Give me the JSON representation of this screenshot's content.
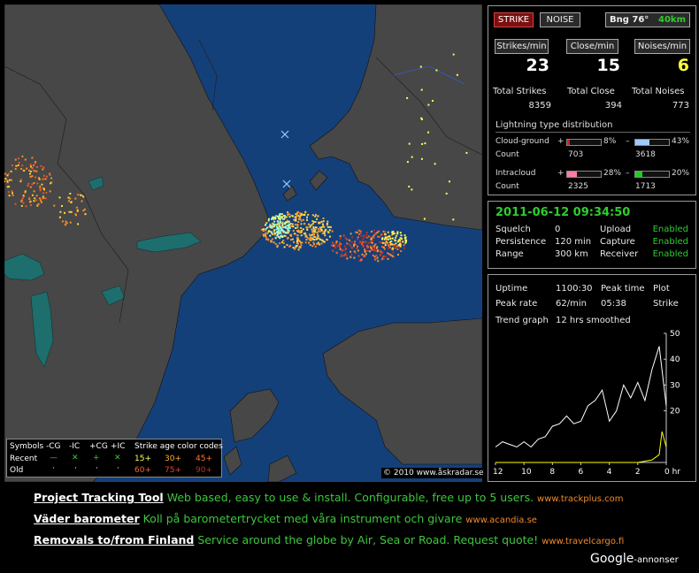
{
  "panel": {
    "strike_btn": "STRIKE",
    "noise_btn": "NOISE",
    "bearing": "Bng 76°",
    "range_km": "40km",
    "strikes_per_min_label": "Strikes/min",
    "close_per_min_label": "Close/min",
    "noises_per_min_label": "Noises/min",
    "strikes_per_min": "23",
    "close_per_min": "15",
    "noises_per_min": "6",
    "total_strikes_label": "Total Strikes",
    "total_close_label": "Total Close",
    "total_noises_label": "Total Noises",
    "total_strikes": "8359",
    "total_close": "394",
    "total_noises": "773",
    "dist_title": "Lightning type distribution",
    "cg_label": "Cloud-ground",
    "ic_label": "Intracloud",
    "count_label": "Count",
    "plus": "+",
    "minus": "–",
    "cg_plus_pct": "8%",
    "cg_minus_pct": "43%",
    "cg_plus_count": "703",
    "cg_minus_count": "3618",
    "ic_plus_pct": "28%",
    "ic_minus_pct": "20%",
    "ic_plus_count": "2325",
    "ic_minus_count": "1713",
    "colors": {
      "cg_plus": "#cc2222",
      "cg_minus": "#9ec9ff",
      "ic_plus": "#ff7aa8",
      "ic_minus": "#22cc22"
    }
  },
  "status": {
    "datetime": "2011-06-12 09:34:50",
    "squelch_label": "Squelch",
    "squelch": "0",
    "persistence_label": "Persistence",
    "persistence": "120 min",
    "range_label": "Range",
    "range": "300 km",
    "upload_label": "Upload",
    "upload": "Enabled",
    "capture_label": "Capture",
    "capture": "Enabled",
    "receiver_label": "Receiver",
    "receiver": "Enabled"
  },
  "stats": {
    "uptime_label": "Uptime",
    "uptime": "1100:30",
    "peak_time_label": "Peak time",
    "peak_time": "05:38",
    "plot_label": "Plot",
    "plot": "Strike",
    "peak_rate_label": "Peak rate",
    "peak_rate": "62/min",
    "trend_label": "Trend graph",
    "trend": "12 hrs smoothed"
  },
  "chart_data": {
    "type": "line",
    "x_ticks": [
      "12",
      "10",
      "8",
      "6",
      "4",
      "2",
      "0 hr"
    ],
    "y_ticks": [
      "50",
      "40",
      "30",
      "20"
    ],
    "ylim": [
      0,
      50
    ],
    "xlim": [
      12,
      0
    ],
    "series": [
      {
        "color": "#ffffff",
        "x": [
          12,
          11.5,
          11,
          10.5,
          10,
          9.5,
          9,
          8.5,
          8,
          7.5,
          7,
          6.5,
          6,
          5.5,
          5,
          4.5,
          4,
          3.5,
          3,
          2.5,
          2,
          1.5,
          1,
          0.5,
          0
        ],
        "values": [
          6,
          8,
          7,
          6,
          8,
          6,
          9,
          10,
          14,
          15,
          18,
          15,
          16,
          22,
          24,
          28,
          16,
          20,
          30,
          25,
          31,
          24,
          36,
          45,
          22
        ]
      },
      {
        "color": "#ffff00",
        "x": [
          12,
          10,
          8,
          6,
          4,
          2,
          1,
          0.5,
          0.3,
          0
        ],
        "values": [
          0,
          0,
          0,
          0,
          0,
          0,
          1,
          3,
          12,
          6
        ]
      }
    ]
  },
  "map": {
    "copyright": "© 2010 www.åskradar.se",
    "legend": {
      "symbols_label": "Symbols",
      "cols": [
        "-CG",
        "-IC",
        "+CG",
        "+IC"
      ],
      "recent_label": "Recent",
      "old_label": "Old",
      "recent_syms": [
        "—",
        "✕",
        "+",
        "✕"
      ],
      "age_title": "Strike age color codes",
      "age_recent": [
        "15+",
        "30+",
        "45+"
      ],
      "age_old": [
        "60+",
        "75+",
        "90+"
      ]
    }
  },
  "ads": [
    {
      "title": "Project Tracking Tool",
      "desc": "Web based, easy to use & install. Configurable, free up to 5 users.",
      "url": "www.trackplus.com"
    },
    {
      "title": "Väder barometer",
      "desc": "Koll på barometertrycket med våra instrument och givare",
      "url": "www.acandia.se"
    },
    {
      "title": "Removals to/from Finland",
      "desc": "Service around the globe by Air, Sea or Road. Request quote!",
      "url": "www.travelcargo.fi"
    }
  ],
  "google_ads": "Google",
  "google_ads_suffix": "-annonser"
}
